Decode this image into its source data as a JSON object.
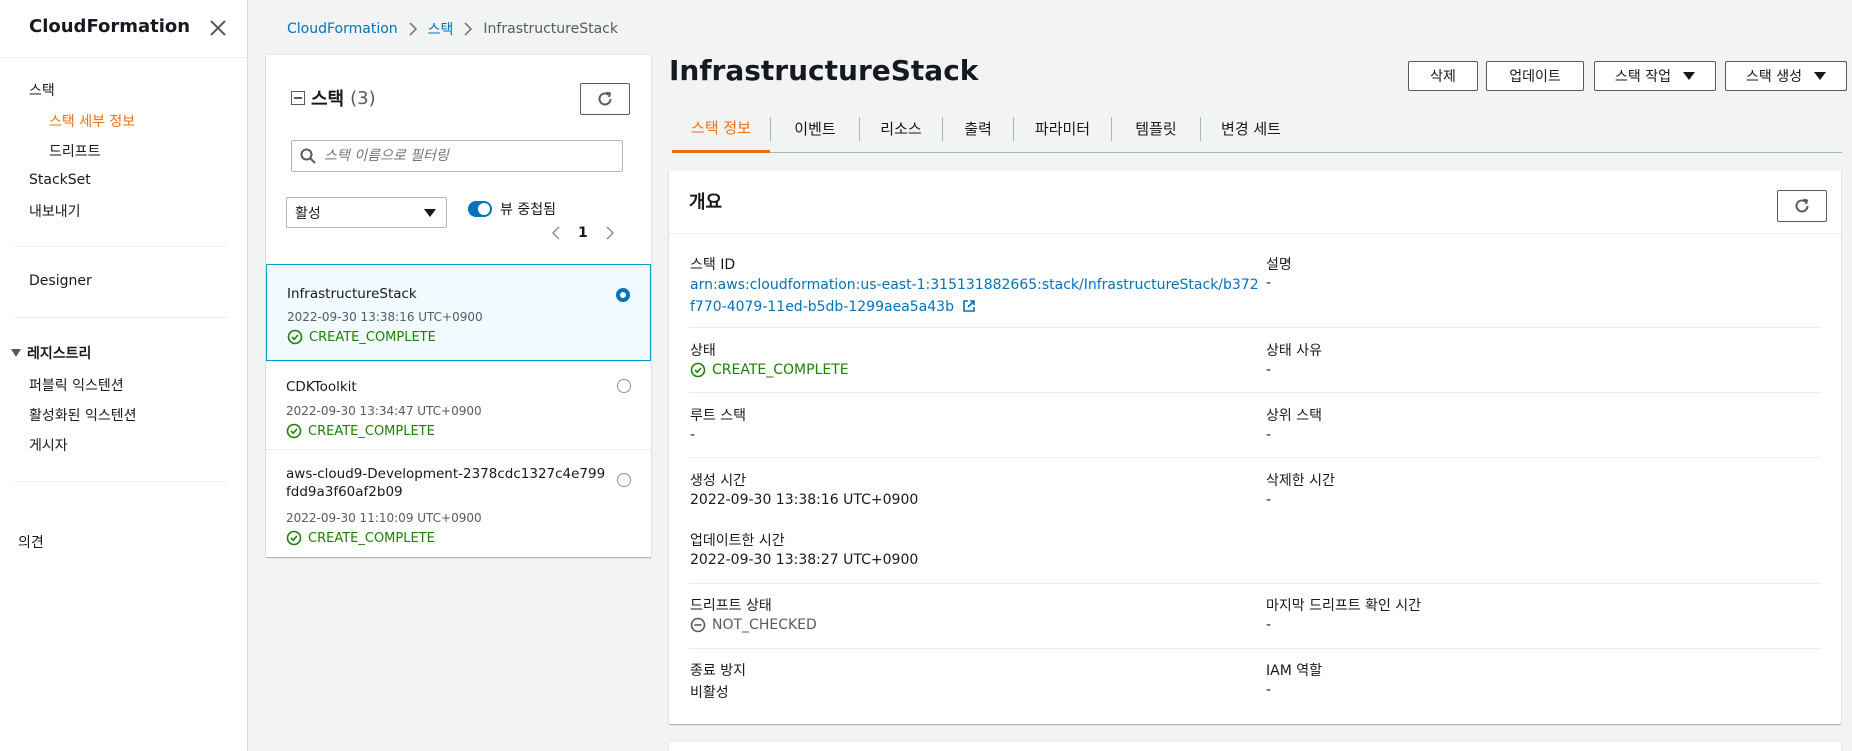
{
  "sidebar": {
    "title": "CloudFormation",
    "items": [
      {
        "label": "스택"
      },
      {
        "label": "스택 세부 정보"
      },
      {
        "label": "드리프트"
      },
      {
        "label": "StackSet"
      },
      {
        "label": "내보내기"
      },
      {
        "label": "Designer"
      },
      {
        "label": "레지스트리"
      },
      {
        "label": "퍼블릭 익스텐션"
      },
      {
        "label": "활성화된 익스텐션"
      },
      {
        "label": "게시자"
      },
      {
        "label": "의견"
      }
    ]
  },
  "breadcrumb": [
    "CloudFormation",
    "스택",
    "InfrastructureStack"
  ],
  "stack_panel": {
    "title": "스택",
    "count": "(3)",
    "search_placeholder": "스택 이름으로 필터링",
    "filter_value": "활성",
    "toggle_label": "뷰 중첩됨",
    "page": "1",
    "stacks": [
      {
        "name": "InfrastructureStack",
        "date": "2022-09-30 13:38:16 UTC+0900",
        "status": "CREATE_COMPLETE"
      },
      {
        "name": "CDKToolkit",
        "date": "2022-09-30 13:34:47 UTC+0900",
        "status": "CREATE_COMPLETE"
      },
      {
        "name": "aws-cloud9-Development-2378cdc1327c4e799fdd9a3f60af2b09",
        "date": "2022-09-30 11:10:09 UTC+0900",
        "status": "CREATE_COMPLETE"
      }
    ]
  },
  "main": {
    "title": "InfrastructureStack",
    "buttons": {
      "delete": "삭제",
      "update": "업데이트",
      "stack_actions": "스택 작업",
      "create_stack": "스택 생성"
    },
    "tabs": [
      "스택 정보",
      "이벤트",
      "리소스",
      "출력",
      "파라미터",
      "템플릿",
      "변경 세트"
    ],
    "overview": {
      "title": "개요",
      "stack_id_label": "스택 ID",
      "stack_id_value": "arn:aws:cloudformation:us-east-1:315131882665:stack/InfrastructureStack/b372f770-4079-11ed-b5db-1299aea5a43b",
      "description_label": "설명",
      "description_value": "-",
      "status_label": "상태",
      "status_value": "CREATE_COMPLETE",
      "status_reason_label": "상태 사유",
      "status_reason_value": "-",
      "root_stack_label": "루트 스택",
      "root_stack_value": "-",
      "parent_stack_label": "상위 스택",
      "parent_stack_value": "-",
      "created_label": "생성 시간",
      "created_value": "2022-09-30 13:38:16 UTC+0900",
      "deleted_label": "삭제한 시간",
      "deleted_value": "-",
      "updated_label": "업데이트한 시간",
      "updated_value": "2022-09-30 13:38:27 UTC+0900",
      "drift_label": "드리프트 상태",
      "drift_value": "NOT_CHECKED",
      "last_drift_label": "마지막 드리프트 확인 시간",
      "last_drift_value": "-",
      "termination_label": "종료 방지",
      "termination_value": "비활성",
      "iam_label": "IAM 역할",
      "iam_value": "-"
    }
  },
  "colors": {
    "accent": "#ec7211",
    "link": "#0073bb",
    "success": "#1d8102"
  }
}
